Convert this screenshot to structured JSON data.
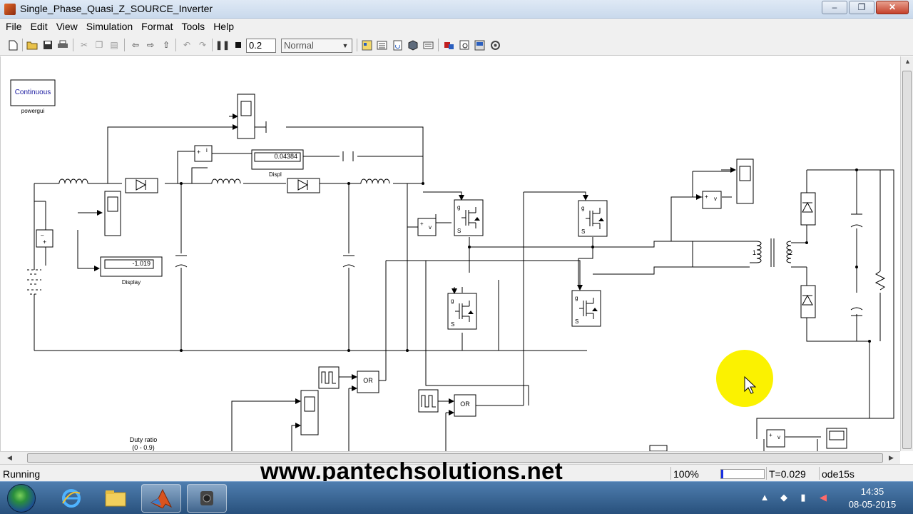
{
  "window": {
    "title": "Single_Phase_Quasi_Z_SOURCE_Inverter",
    "minimize_glyph": "–",
    "restore_glyph": "❐",
    "close_glyph": "✕"
  },
  "menu": [
    "File",
    "Edit",
    "View",
    "Simulation",
    "Format",
    "Tools",
    "Help"
  ],
  "toolbar": {
    "stop_time": "0.2",
    "sim_mode": "Normal",
    "icons": [
      "new-icon",
      "open-icon",
      "save-icon",
      "print-icon",
      "cut-icon",
      "copy-icon",
      "paste-icon",
      "back-icon",
      "forward-icon",
      "up-icon",
      "undo-icon",
      "redo-icon",
      "pause-icon",
      "stop-icon",
      "library-icon",
      "model-explorer-icon",
      "update-icon",
      "build-icon",
      "debug-icon",
      "port-icon",
      "find-icon",
      "props-icon",
      "settings-icon"
    ]
  },
  "diagram": {
    "powergui_label": "Continuous",
    "powergui_name": "powergui",
    "display1_value": "0.04384",
    "display1_caption": "Displ",
    "display2_value": "-1.019",
    "display2_caption": "Display",
    "duty_ratio_label": "Duty ratio",
    "duty_ratio_range": "(0 - 0.9)",
    "or_label": "OR",
    "transformer_p": "1",
    "transformer_s": "2",
    "vm_label": "v",
    "im_label": "i",
    "mosfet_g": "g",
    "mosfet_s": "S"
  },
  "status": {
    "state": "Running",
    "zoom": "100%",
    "progress": 0.05,
    "time": "T=0.029",
    "solver": "ode15s"
  },
  "watermark": "www.pantechsolutions.net",
  "taskbar": {
    "time": "14:35",
    "date": "08-05-2015"
  }
}
